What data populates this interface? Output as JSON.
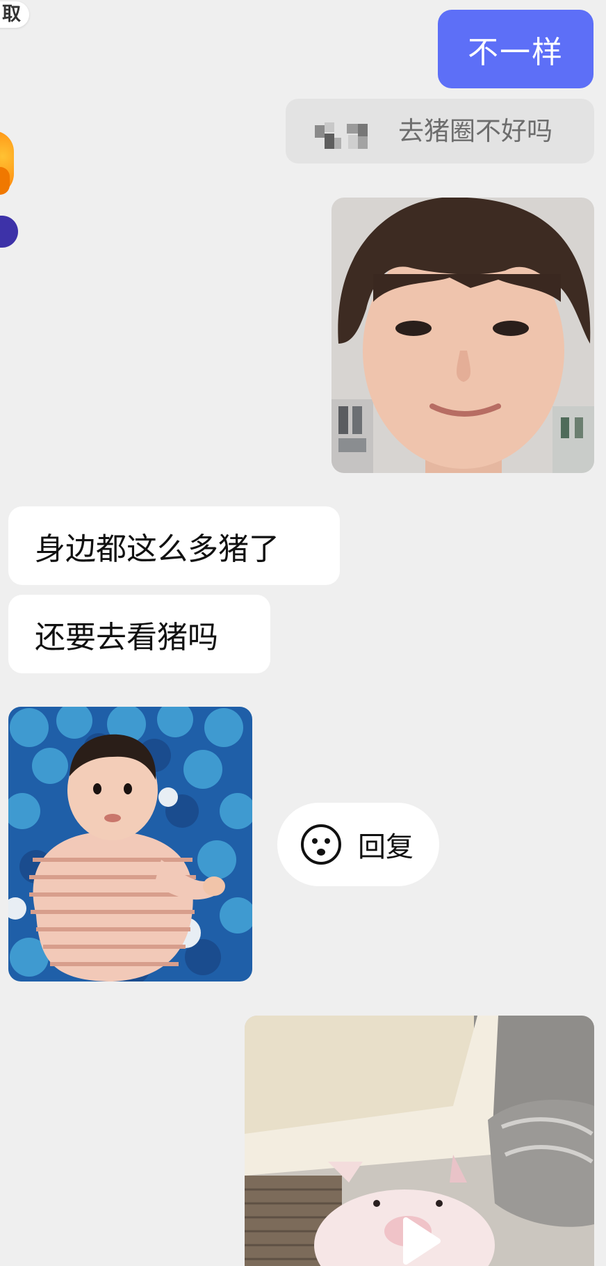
{
  "top_pill": {
    "label": "取"
  },
  "messages": {
    "outgoing_text": "不一样",
    "quote": {
      "text": "去猪圈不好吗"
    },
    "incoming_1": "身边都这么多猪了",
    "incoming_2": "还要去看猪吗"
  },
  "reply_button": {
    "label": "回复",
    "icon": "smiley-face-icon"
  },
  "images": {
    "boy_photo": "boy-face-photo",
    "baby_photo": "baby-ball-pit-photo",
    "pig_video": "piglet-video-thumbnail"
  },
  "colors": {
    "background": "#efefef",
    "outgoing_bubble": "#5d6ff7",
    "quote_background": "#e3e3e3",
    "incoming_bubble": "#ffffff"
  }
}
